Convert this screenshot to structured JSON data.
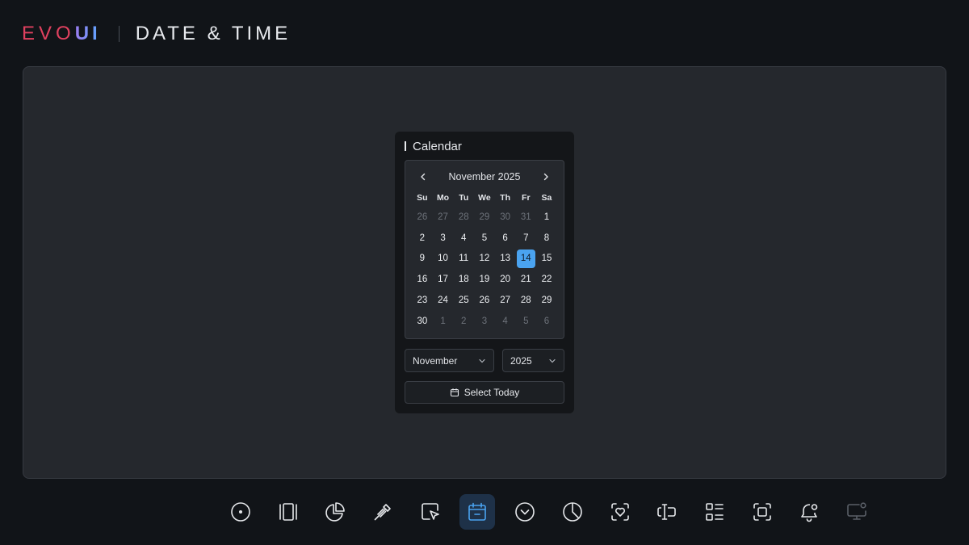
{
  "header": {
    "logo_part1": "EVO",
    "logo_part2": "UI",
    "title": "DATE & TIME"
  },
  "card": {
    "title": "Calendar"
  },
  "calendar": {
    "month_label": "November 2025",
    "weekdays": [
      "Su",
      "Mo",
      "Tu",
      "We",
      "Th",
      "Fr",
      "Sa"
    ],
    "days": [
      {
        "d": "26",
        "m": true
      },
      {
        "d": "27",
        "m": true
      },
      {
        "d": "28",
        "m": true
      },
      {
        "d": "29",
        "m": true
      },
      {
        "d": "30",
        "m": true
      },
      {
        "d": "31",
        "m": true
      },
      {
        "d": "1"
      },
      {
        "d": "2"
      },
      {
        "d": "3"
      },
      {
        "d": "4"
      },
      {
        "d": "5"
      },
      {
        "d": "6"
      },
      {
        "d": "7"
      },
      {
        "d": "8"
      },
      {
        "d": "9"
      },
      {
        "d": "10"
      },
      {
        "d": "11"
      },
      {
        "d": "12"
      },
      {
        "d": "13"
      },
      {
        "d": "14",
        "s": true
      },
      {
        "d": "15"
      },
      {
        "d": "16"
      },
      {
        "d": "17"
      },
      {
        "d": "18"
      },
      {
        "d": "19"
      },
      {
        "d": "20"
      },
      {
        "d": "21"
      },
      {
        "d": "22"
      },
      {
        "d": "23"
      },
      {
        "d": "24"
      },
      {
        "d": "25"
      },
      {
        "d": "26"
      },
      {
        "d": "27"
      },
      {
        "d": "28"
      },
      {
        "d": "29"
      },
      {
        "d": "30"
      },
      {
        "d": "1",
        "m": true
      },
      {
        "d": "2",
        "m": true
      },
      {
        "d": "3",
        "m": true
      },
      {
        "d": "4",
        "m": true
      },
      {
        "d": "5",
        "m": true
      },
      {
        "d": "6",
        "m": true
      }
    ],
    "selected_day": "14"
  },
  "controls": {
    "month_select": "November",
    "year_select": "2025",
    "today_label": "Select Today"
  },
  "toolbar": {
    "items": [
      "radio-icon",
      "carousel-icon",
      "pie-chart-icon",
      "color-picker-icon",
      "cursor-select-icon",
      "calendar-icon",
      "chevron-circle-icon",
      "donut-icon",
      "favorite-scan-icon",
      "text-input-icon",
      "list-layout-icon",
      "fullscreen-icon",
      "notification-bell-icon",
      "monitor-icon"
    ],
    "active": "calendar-icon"
  },
  "colors": {
    "accent": "#4aa3f0",
    "brand_red": "#e0415f",
    "active_tab_bg": "#1e3148"
  }
}
